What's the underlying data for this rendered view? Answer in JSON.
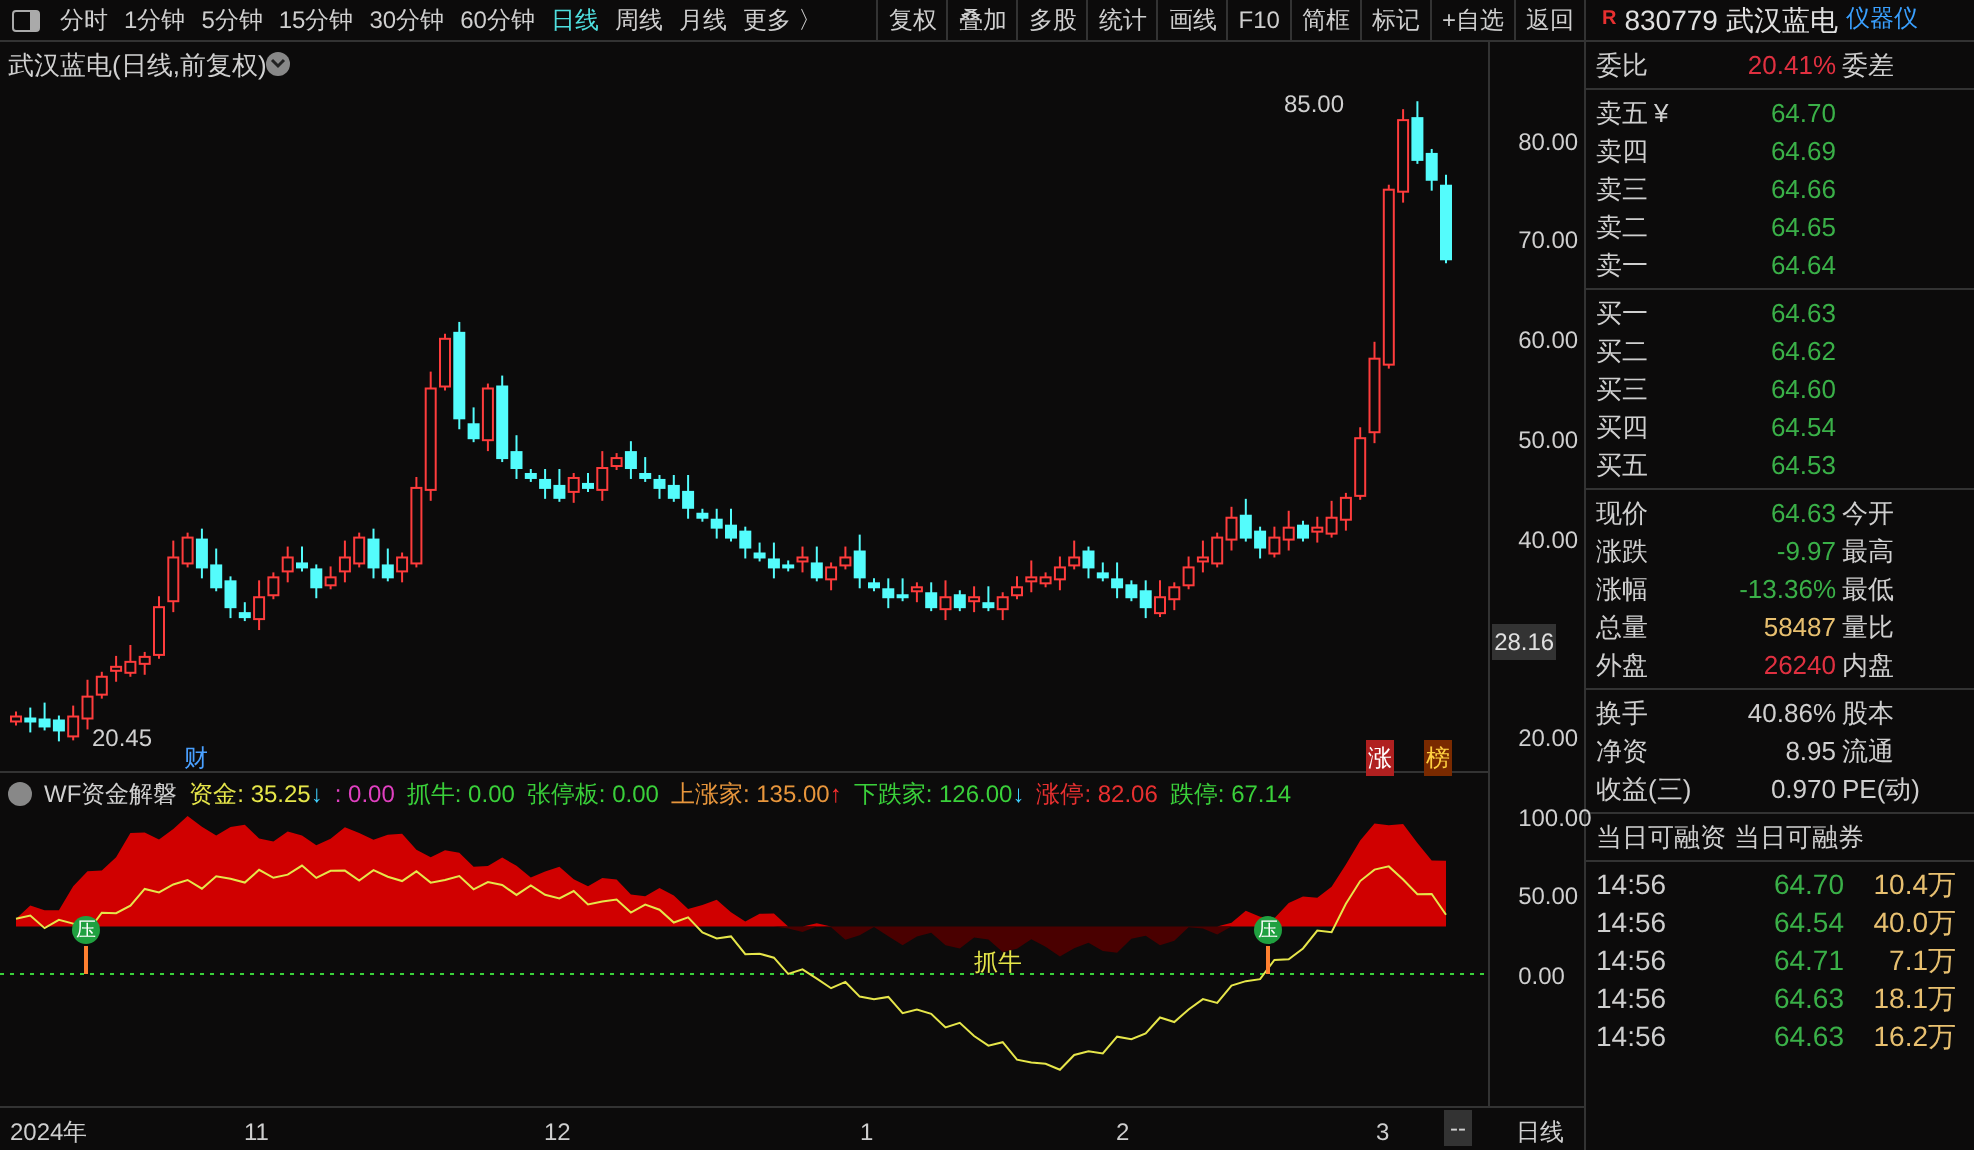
{
  "toolbar": {
    "periods": [
      {
        "label": "分时",
        "selected": false
      },
      {
        "label": "1分钟",
        "selected": false
      },
      {
        "label": "5分钟",
        "selected": false
      },
      {
        "label": "15分钟",
        "selected": false
      },
      {
        "label": "30分钟",
        "selected": false
      },
      {
        "label": "60分钟",
        "selected": false
      },
      {
        "label": "日线",
        "selected": true
      },
      {
        "label": "周线",
        "selected": false
      },
      {
        "label": "月线",
        "selected": false
      }
    ],
    "more": "更多 〉",
    "buttons": [
      "复权",
      "叠加",
      "多股",
      "统计",
      "画线",
      "F10",
      "简框",
      "标记",
      "+自选",
      "返回"
    ]
  },
  "quote_header": {
    "badge": "R",
    "code_name": "830779 武汉蓝电",
    "tag": "仪器仪"
  },
  "price_chart": {
    "title": "武汉蓝电(日线,前复权)",
    "y_labels": [
      "80.00",
      "70.00",
      "60.00",
      "50.00",
      "40.00",
      "20.00"
    ],
    "current_price": "28.16",
    "high_label": "85.00",
    "low_label": "20.45",
    "markers": [
      {
        "text": "财",
        "kind": "finance"
      },
      {
        "text": "涨",
        "kind": "rise"
      },
      {
        "text": "榜",
        "kind": "list"
      }
    ]
  },
  "indicator": {
    "name": "WF资金解磐",
    "legend": [
      {
        "text": "资金: 35.25",
        "color": "#e6e64a",
        "arrow": {
          "glyph": "↓",
          "color": "#40d0ff"
        }
      },
      {
        "text": ": 0.00",
        "color": "#e040c0"
      },
      {
        "text": "抓牛: 0.00",
        "color": "#3ad03a"
      },
      {
        "text": "张停板: 0.00",
        "color": "#3ad03a"
      },
      {
        "text": "上涨家: 135.00",
        "color": "#e8963c",
        "arrow": {
          "glyph": "↑",
          "color": "#ff3030"
        }
      },
      {
        "text": "下跌家: 126.00",
        "color": "#3ad03a",
        "arrow": {
          "glyph": "↓",
          "color": "#40d0ff"
        }
      },
      {
        "text": "涨停: 82.06",
        "color": "#e83030"
      },
      {
        "text": "跌停: 67.14",
        "color": "#3ad03a"
      }
    ],
    "y_labels": [
      "100.00",
      "50.00",
      "0.00"
    ],
    "signal_label": "抓牛",
    "pressure_marks": [
      "压",
      "压"
    ]
  },
  "time_axis": {
    "labels": [
      "2024年",
      "11",
      "12",
      "1",
      "2",
      "3"
    ],
    "end_button": "--",
    "period": "日线"
  },
  "quote_panel": {
    "ratio": {
      "label": "委比",
      "value": "20.41%",
      "label2": "委差"
    },
    "asks": [
      {
        "label": "卖五",
        "extra": "¥",
        "price": "64.70"
      },
      {
        "label": "卖四",
        "price": "64.69"
      },
      {
        "label": "卖三",
        "price": "64.66"
      },
      {
        "label": "卖二",
        "price": "64.65"
      },
      {
        "label": "卖一",
        "price": "64.64"
      }
    ],
    "bids": [
      {
        "label": "买一",
        "price": "64.63"
      },
      {
        "label": "买二",
        "price": "64.62"
      },
      {
        "label": "买三",
        "price": "64.60"
      },
      {
        "label": "买四",
        "price": "64.54"
      },
      {
        "label": "买五",
        "price": "64.53"
      }
    ],
    "stats": [
      {
        "label": "现价",
        "value": "64.63",
        "label2": "今开",
        "kind": "down"
      },
      {
        "label": "涨跌",
        "value": "-9.97",
        "label2": "最高",
        "kind": "down"
      },
      {
        "label": "涨幅",
        "value": "-13.36%",
        "label2": "最低",
        "kind": "down"
      },
      {
        "label": "总量",
        "value": "58487",
        "label2": "量比",
        "kind": "volume"
      },
      {
        "label": "外盘",
        "value": "26240",
        "label2": "内盘",
        "kind": "up"
      }
    ],
    "fundamentals": [
      {
        "label": "换手",
        "value": "40.86%",
        "label2": "股本"
      },
      {
        "label": "净资",
        "value": "8.95",
        "label2": "流通"
      },
      {
        "label": "收益(三)",
        "value": "0.970",
        "label2": "PE(动)"
      }
    ],
    "margin_header": [
      "当日可融资",
      "当日可融券"
    ],
    "ticks": [
      {
        "time": "14:56",
        "price": "64.70",
        "volume": "10.4万"
      },
      {
        "time": "14:56",
        "price": "64.54",
        "volume": "40.0万"
      },
      {
        "time": "14:56",
        "price": "64.71",
        "volume": "7.1万"
      },
      {
        "time": "14:56",
        "price": "64.63",
        "volume": "18.1万"
      },
      {
        "time": "14:56",
        "price": "64.63",
        "volume": "16.2万"
      }
    ]
  }
}
